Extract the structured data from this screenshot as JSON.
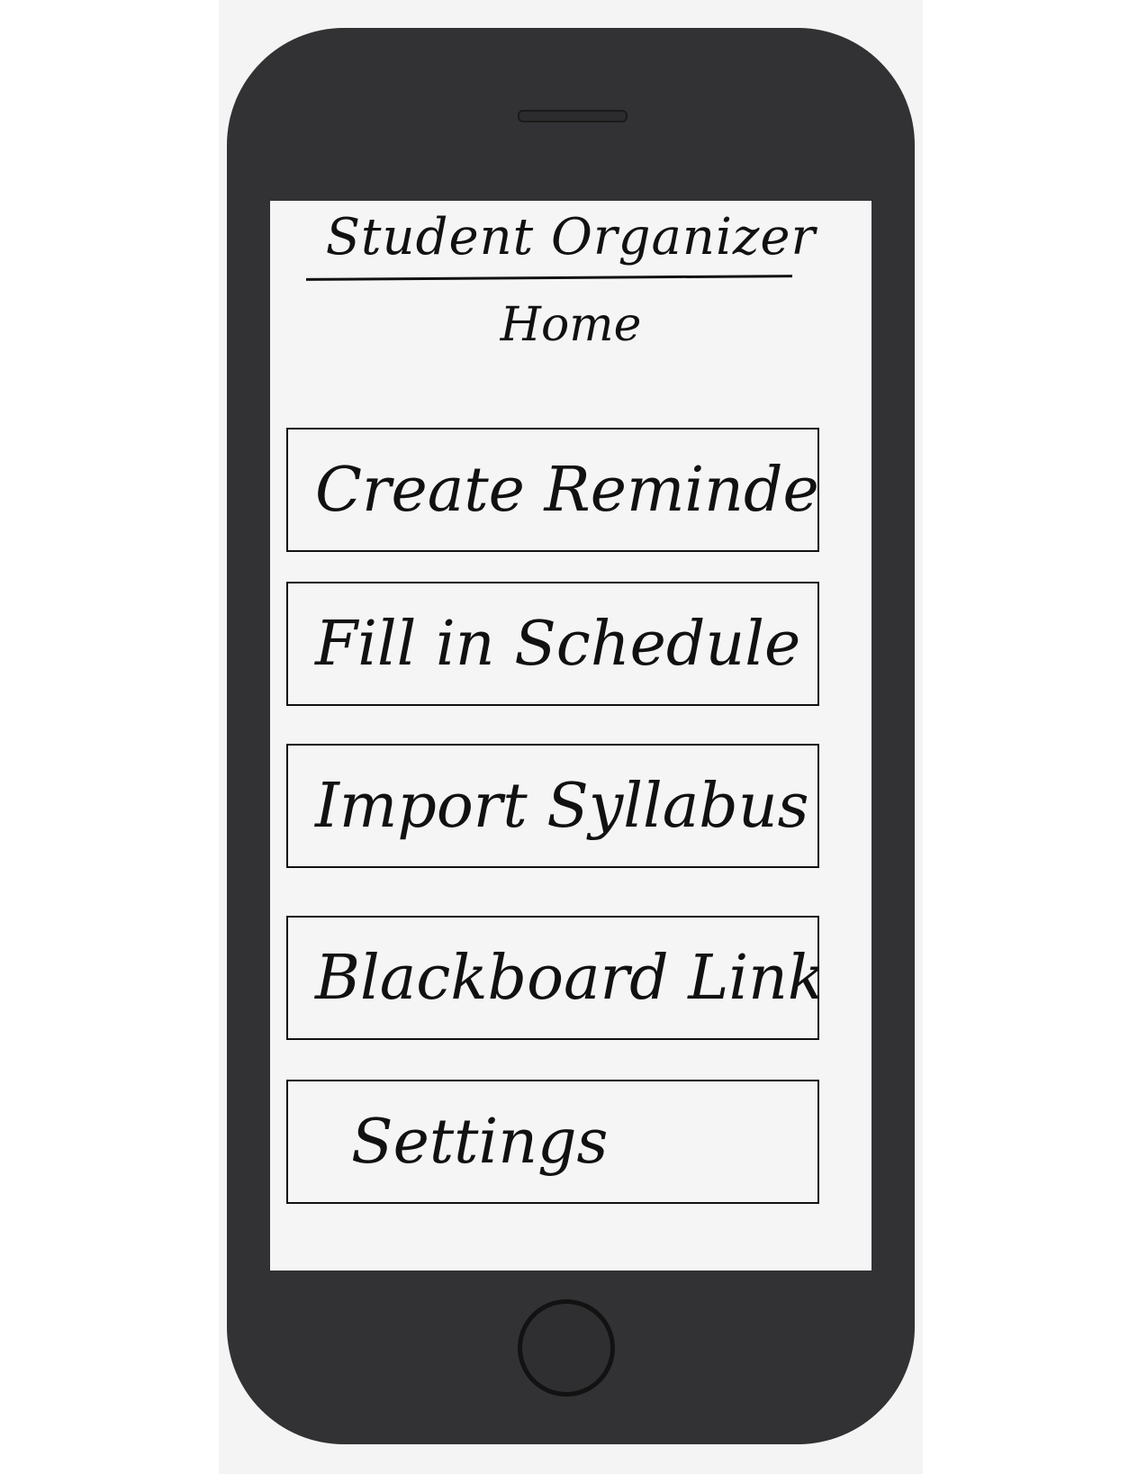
{
  "app": {
    "title": "Student Organizer",
    "page_title": "Home"
  },
  "menu": {
    "items": [
      {
        "label": "Create Reminder"
      },
      {
        "label": "Fill in Schedule"
      },
      {
        "label": "Import Syllabus"
      },
      {
        "label": "Blackboard Link"
      },
      {
        "label": "Settings"
      }
    ]
  },
  "colors": {
    "phone_body": "#323234",
    "screen": "#f5f5f5",
    "ink": "#111111"
  }
}
